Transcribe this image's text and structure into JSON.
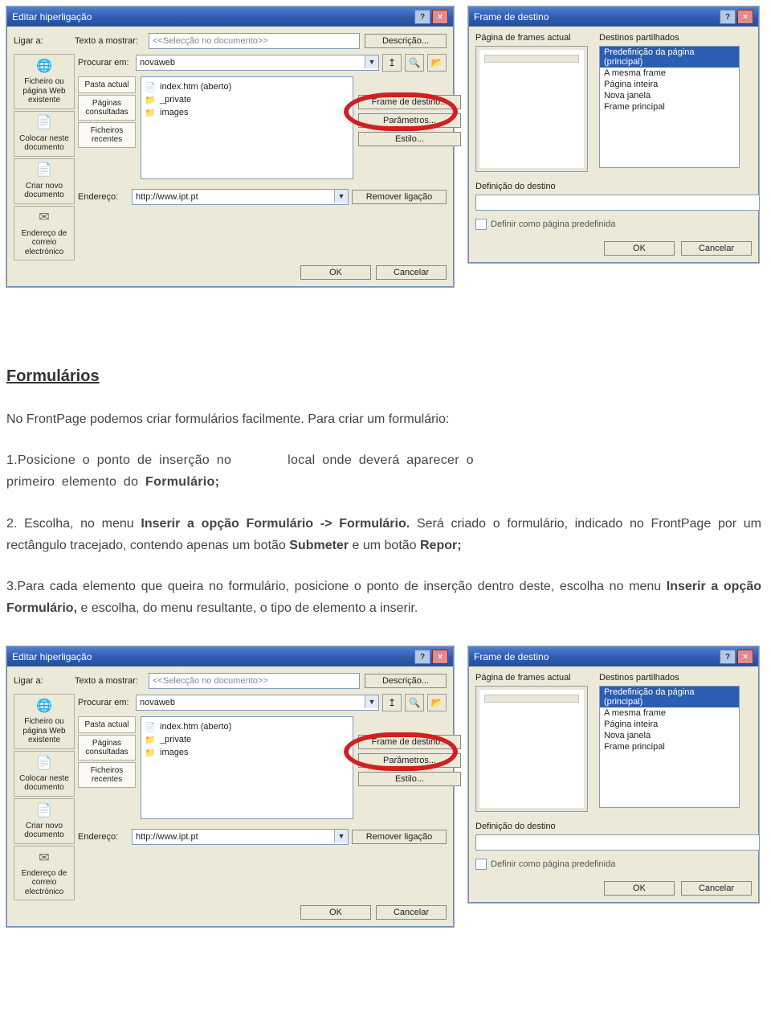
{
  "dlg1": {
    "title": "Editar hiperligação",
    "link_a_label": "Ligar a:",
    "text_to_show_label": "Texto a mostrar:",
    "text_to_show_value": "<<Selecção no documento>>",
    "desc_btn": "Descrição...",
    "search_in_label": "Procurar em:",
    "search_in_value": "novaweb",
    "sidebar": [
      {
        "label": "Ficheiro ou página Web existente",
        "icon": "🌐"
      },
      {
        "label": "Colocar neste documento",
        "icon": "📄"
      },
      {
        "label": "Criar novo documento",
        "icon": "📄"
      },
      {
        "label": "Endereço de correio electrónico",
        "icon": "✉"
      }
    ],
    "tabs": [
      {
        "label": "Pasta actual"
      },
      {
        "label": "Páginas consultadas"
      },
      {
        "label": "Ficheiros recentes"
      }
    ],
    "files": [
      {
        "name": "index.htm (aberto)",
        "icon": "blue",
        "glyph": "📄"
      },
      {
        "name": "_private",
        "icon": "yellow",
        "glyph": "📁"
      },
      {
        "name": "images",
        "icon": "yellow",
        "glyph": "📁"
      }
    ],
    "right_buttons": {
      "frame": "Frame de destino...",
      "params": "Parâmetros...",
      "style": "Estilo..."
    },
    "address_label": "Endereço:",
    "address_value": "http://www.ipt.pt",
    "remove_btn": "Remover ligação",
    "ok_btn": "OK",
    "cancel_btn": "Cancelar",
    "toolbar_icons": {
      "up": "↥",
      "web": "🔍",
      "open": "📂"
    }
  },
  "dlg2": {
    "title": "Frame de destino",
    "col1_label": "Página de frames actual",
    "col2_label": "Destinos partilhados",
    "destinations": [
      {
        "label": "Predefinição da página (principal)",
        "selected": true
      },
      {
        "label": "A mesma frame"
      },
      {
        "label": "Página inteira"
      },
      {
        "label": "Nova janela"
      },
      {
        "label": "Frame principal"
      }
    ],
    "def_label": "Definição do destino",
    "chk_label": "Definir como página predefinida",
    "ok_btn": "OK",
    "cancel_btn": "Cancelar"
  },
  "doc": {
    "heading": "Formulários",
    "p1": "No FrontPage podemos criar formulários facilmente. Para criar um formulário:",
    "p2_a": "1.Posicione  o  ponto  de  inserção  no",
    "p2_b": "local   onde  deverá     aparecer     o",
    "p2_c": "primeiro    elemento    do ",
    "p2_d": "Formulário;",
    "p3_a": "2.    Escolha,  no  menu ",
    "p3_b": "Inserir  a  opção  Formulário  ->  Formulário.",
    "p3_c": " Será  criado  o formulário, indicado no FrontPage por um rectângulo tracejado, contendo apenas um botão ",
    "p3_d": "Submeter",
    "p3_e": " e um botão ",
    "p3_f": "Repor;",
    "p4_a": "3.Para  cada  elemento   que   queira   no   formulário,  posicione o ponto de inserção   dentro  deste, escolha no menu ",
    "p4_b": "Inserir  a  opção  Formulário,",
    "p4_c": " e escolha, do menu resultante, o tipo de elemento a inserir."
  }
}
